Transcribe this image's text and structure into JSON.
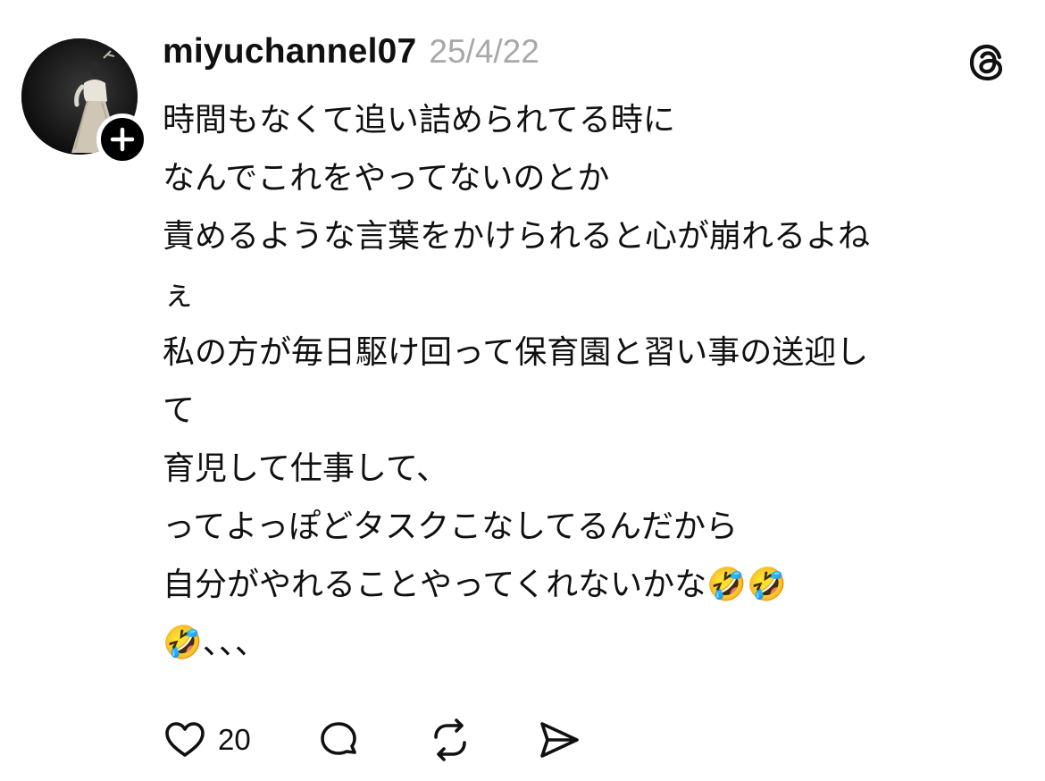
{
  "post": {
    "username": "miyuchannel07",
    "timestamp": "25/4/22",
    "avatar_icon": "profile-photo",
    "follow_icon": "plus-icon",
    "logo_icon": "threads-logo",
    "text_lines": [
      "時間もなくて追い詰められてる時に",
      "なんでこれをやってないのとか",
      "責めるような言葉をかけられると心が崩れるよね",
      "ぇ",
      "私の方が毎日駆け回って保育園と習い事の送迎し",
      "て",
      "育児して仕事して、",
      "ってよっぽどタスクこなしてるんだから",
      "自分がやれることやってくれないかな🤣🤣",
      "🤣、、、"
    ]
  },
  "actions": {
    "like_icon": "heart-icon",
    "like_count": "20",
    "reply_icon": "comment-icon",
    "repost_icon": "repost-icon",
    "share_icon": "send-icon"
  },
  "colors": {
    "text": "#101010",
    "muted": "#a8a8a8",
    "background": "#ffffff"
  }
}
